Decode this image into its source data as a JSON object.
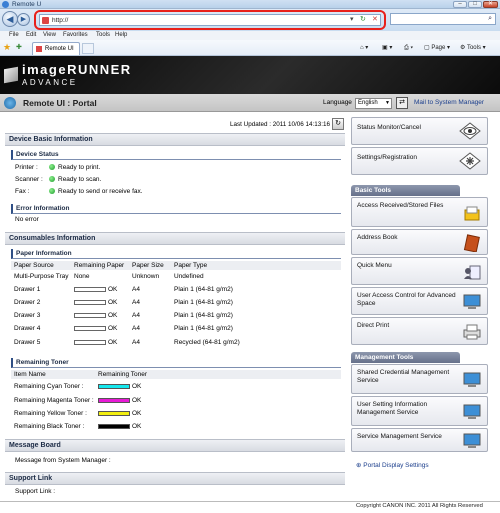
{
  "browser": {
    "title": "Remote U",
    "address": "http://",
    "menu": [
      "File",
      "Edit",
      "View",
      "Favorites",
      "Tools",
      "Help"
    ],
    "tab_label": "Remote UI",
    "toolbar": [
      "Page",
      "Tools"
    ],
    "addr_controls": [
      "▾",
      "↻",
      "✕"
    ],
    "search_icon": "search-icon",
    "win_buttons": [
      "–",
      "□",
      "✕"
    ]
  },
  "header": {
    "brand_line1": "imageRUNNER",
    "brand_line2": "ADVANCE",
    "portal_title": "Remote UI : Portal",
    "language_label": "Language",
    "language_value": "English",
    "mail_link": "Mail to System Manager"
  },
  "main": {
    "last_updated": "Last Updated : 2011 10/06 14:13:16",
    "device_basic": {
      "title": "Device Basic Information",
      "status_title": "Device Status",
      "status": [
        {
          "label": "Printer :",
          "value": "Ready to print."
        },
        {
          "label": "Scanner :",
          "value": "Ready to scan."
        },
        {
          "label": "Fax :",
          "value": "Ready to send or receive fax."
        }
      ],
      "error_title": "Error Information",
      "error_value": "No error"
    },
    "consumables": {
      "title": "Consumables Information",
      "paper_title": "Paper Information",
      "paper_headers": [
        "Paper Source",
        "Remaining Paper",
        "Paper Size",
        "Paper Type"
      ],
      "paper_rows": [
        {
          "source": "Multi-Purpose Tray",
          "remaining": "None",
          "level": null,
          "size": "Unknown",
          "type": "Undefined"
        },
        {
          "source": "Drawer 1",
          "remaining": "OK",
          "level": 0,
          "size": "A4",
          "type": "Plain 1 (64-81 g/m2)"
        },
        {
          "source": "Drawer 2",
          "remaining": "OK",
          "level": 0,
          "size": "A4",
          "type": "Plain 1 (64-81 g/m2)"
        },
        {
          "source": "Drawer 3",
          "remaining": "OK",
          "level": 0,
          "size": "A4",
          "type": "Plain 1 (64-81 g/m2)"
        },
        {
          "source": "Drawer 4",
          "remaining": "OK",
          "level": 0,
          "size": "A4",
          "type": "Plain 1 (64-81 g/m2)"
        },
        {
          "source": "Drawer 5",
          "remaining": "OK",
          "level": 0,
          "size": "A4",
          "type": "Recycled (64-81 g/m2)"
        }
      ],
      "toner_title": "Remaining Toner",
      "toner_headers": [
        "Item Name",
        "Remaining Toner"
      ],
      "toner_rows": [
        {
          "name": "Remaining Cyan Toner :",
          "status": "OK",
          "color": "#16e8ee"
        },
        {
          "name": "Remaining Magenta Toner :",
          "status": "OK",
          "color": "#e81ad6"
        },
        {
          "name": "Remaining Yellow Toner :",
          "status": "OK",
          "color": "#f2ef10"
        },
        {
          "name": "Remaining Black Toner :",
          "status": "OK",
          "color": "#000000"
        }
      ]
    },
    "message_board": {
      "title": "Message Board",
      "label": "Message from System Manager :"
    },
    "support": {
      "title": "Support Link",
      "label": "Support Link :"
    }
  },
  "right": {
    "top_buttons": [
      {
        "label": "Status Monitor/Cancel",
        "icon": "status-eye-icon"
      },
      {
        "label": "Settings/Registration",
        "icon": "settings-icon"
      }
    ],
    "basic_tools_title": "Basic Tools",
    "basic_tools": [
      {
        "label": "Access Received/Stored Files",
        "icon": "files-icon"
      },
      {
        "label": "Address Book",
        "icon": "address-book-icon"
      },
      {
        "label": "Quick Menu",
        "icon": "quick-menu-icon"
      },
      {
        "label": "User Access Control for Advanced Space",
        "icon": "monitor-icon"
      },
      {
        "label": "Direct Print",
        "icon": "printer-icon"
      }
    ],
    "management_title": "Management Tools",
    "management_tools": [
      {
        "label": "Shared Credential Management Service",
        "icon": "monitor-icon"
      },
      {
        "label": "User Setting Information Management Service",
        "icon": "monitor-icon"
      },
      {
        "label": "Service Management Service",
        "icon": "monitor-icon"
      }
    ],
    "portal_display": "Portal Display Settings",
    "copyright": "Copyright CANON INC. 2011 All Rights Reserved"
  },
  "colors": {
    "accent": "#e8201b",
    "status_ok": "#1b9a2b",
    "link": "#1b3e8c"
  }
}
